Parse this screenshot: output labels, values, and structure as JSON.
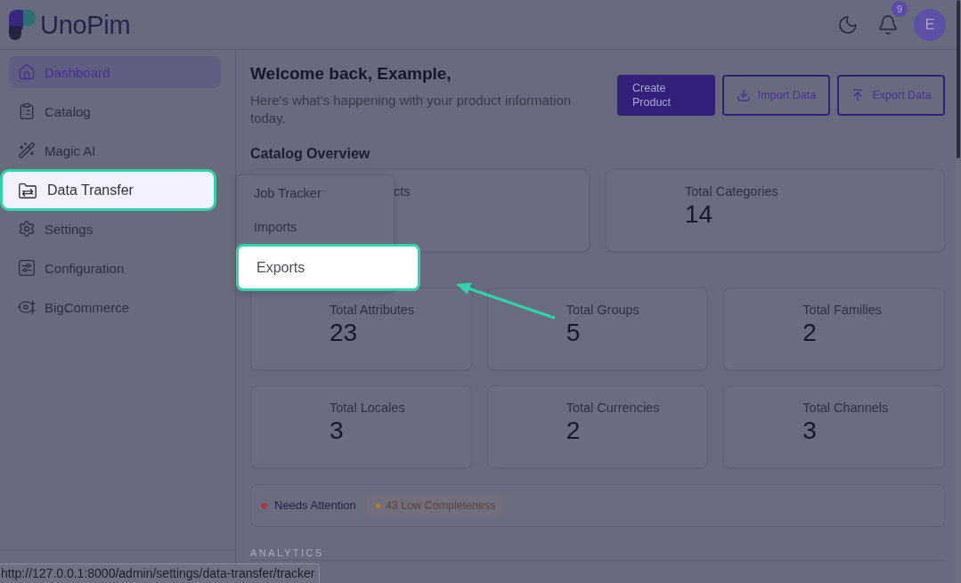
{
  "header": {
    "logo": {
      "text": "UnoPim"
    },
    "notifications": {
      "count": "9"
    },
    "avatar": {
      "initial": "E"
    }
  },
  "sidebar": {
    "items": [
      {
        "label": "Dashboard",
        "selected": true,
        "highlighted": false
      },
      {
        "label": "Catalog",
        "selected": false,
        "highlighted": false
      },
      {
        "label": "Magic AI",
        "selected": false,
        "highlighted": false
      },
      {
        "label": "Data Transfer",
        "selected": false,
        "highlighted": true,
        "submenu": [
          {
            "label": "Job Tracker",
            "highlighted": false
          },
          {
            "label": "Imports",
            "highlighted": false
          },
          {
            "label": "Exports",
            "highlighted": true
          }
        ]
      },
      {
        "label": "Settings",
        "selected": false,
        "highlighted": false
      },
      {
        "label": "Configuration",
        "selected": false,
        "highlighted": false
      },
      {
        "label": "BigCommerce",
        "selected": false,
        "highlighted": false
      }
    ]
  },
  "page": {
    "title": "Welcome back, Example,",
    "subtitle": "Here's what's happening with your product information today.",
    "actions": [
      {
        "label": "Create Product",
        "kind": "primary"
      },
      {
        "label": "Import Data",
        "kind": "outline"
      },
      {
        "label": "Export Data",
        "kind": "outline"
      }
    ]
  },
  "catalog_overview": {
    "title": "Catalog Overview",
    "rows": [
      [
        {
          "label": "cts",
          "kind": "covered"
        },
        {
          "label": "Total Categories",
          "value": "14",
          "kind": "stat"
        }
      ],
      [
        {
          "label": "Total Attributes",
          "value": "23",
          "kind": "stat"
        },
        {
          "label": "Total Groups",
          "value": "5",
          "kind": "stat"
        },
        {
          "label": "Total Families",
          "value": "2",
          "kind": "stat"
        }
      ],
      [
        {
          "label": "Total Locales",
          "value": "3",
          "kind": "stat"
        },
        {
          "label": "Total Currencies",
          "value": "2",
          "kind": "stat"
        },
        {
          "label": "Total Channels",
          "value": "3",
          "kind": "stat"
        }
      ]
    ]
  },
  "attention": {
    "items": [
      {
        "label": "Needs Attention",
        "color": "#b3344f",
        "kind": "plain"
      },
      {
        "label": "43 Low Completeness",
        "color": "#b5802c",
        "kind": "pill"
      }
    ]
  },
  "analytics": {
    "title": "ANALYTICS"
  },
  "status_bar": {
    "url": "http://127.0.0.1:8000/admin/settings/data-transfer/tracker"
  }
}
